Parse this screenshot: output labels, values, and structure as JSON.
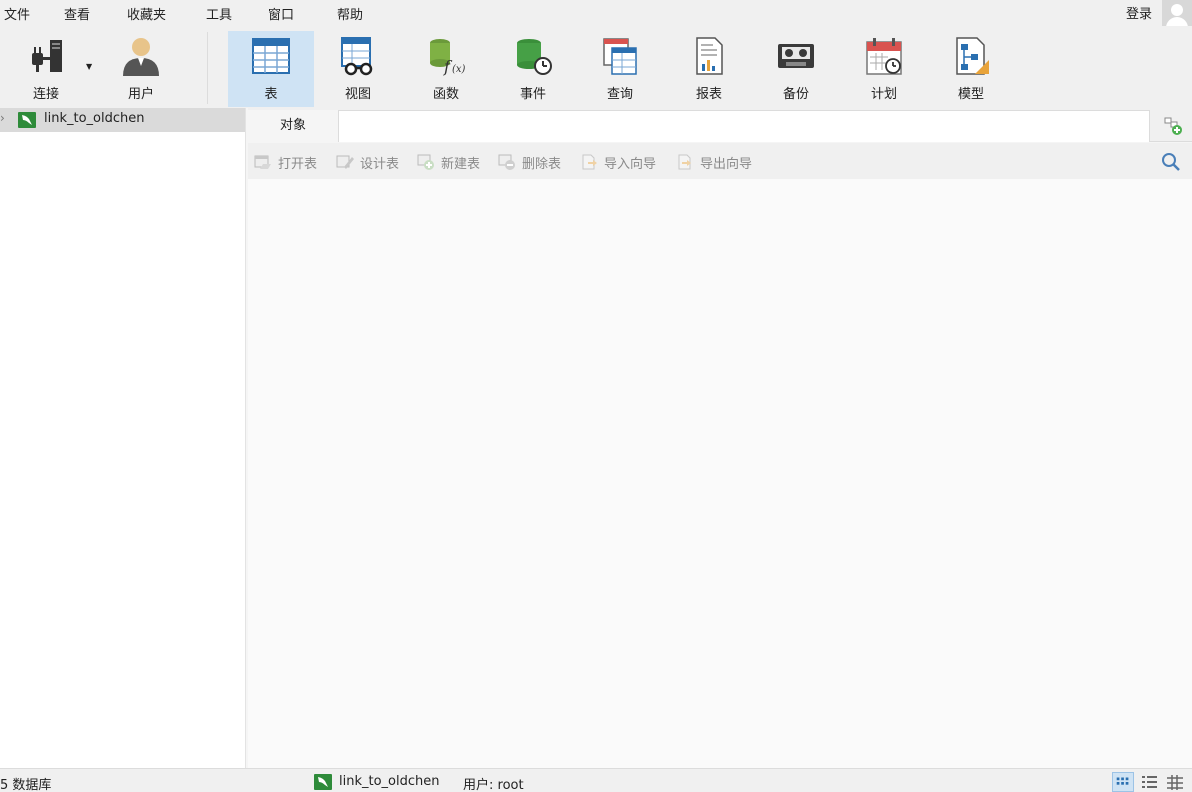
{
  "menu": [
    "文件",
    "查看",
    "收藏夹",
    "工具",
    "窗口",
    "帮助"
  ],
  "login_label": "登录",
  "toolbar": {
    "connection_label": "连接",
    "user_label": "用户",
    "table_label": "表",
    "view_label": "视图",
    "function_label": "函数",
    "event_label": "事件",
    "query_label": "查询",
    "report_label": "报表",
    "backup_label": "备份",
    "schedule_label": "计划",
    "model_label": "模型"
  },
  "tree": {
    "connection_name": "link_to_oldchen"
  },
  "tabs": {
    "objects_label": "对象"
  },
  "object_toolbar": {
    "open_table": "打开表",
    "design_table": "设计表",
    "new_table": "新建表",
    "delete_table": "删除表",
    "import_wizard": "导入向导",
    "export_wizard": "导出向导"
  },
  "status": {
    "db_count": "5 数据库",
    "connection": "link_to_oldchen",
    "user": "用户: root"
  },
  "colors": {
    "accent": "#cfe3f4",
    "mysql_green": "#2e8b3a"
  }
}
